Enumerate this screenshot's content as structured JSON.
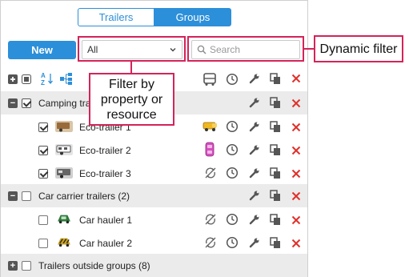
{
  "tabs": [
    {
      "label": "Trailers",
      "active": false
    },
    {
      "label": "Groups",
      "active": true
    }
  ],
  "toolbar": {
    "new_label": "New"
  },
  "filter": {
    "selected": "All"
  },
  "search": {
    "placeholder": "Search"
  },
  "callouts": {
    "dynamic_filter": "Dynamic filter",
    "filter_by": "Filter by property or resource"
  },
  "groups": [
    {
      "name": "Camping trailers (3)",
      "expanded": true,
      "checked": true,
      "items": [
        {
          "name": "Eco-trailer 1",
          "checked": true,
          "status_icon": "yellow-van-icon",
          "thumb_color": "#9a6b3a"
        },
        {
          "name": "Eco-trailer 2",
          "checked": true,
          "status_icon": "pink-trailer-icon",
          "thumb_color": "#777777"
        },
        {
          "name": "Eco-trailer 3",
          "checked": true,
          "status_icon": "sync-off-icon",
          "thumb_color": "#666666"
        }
      ]
    },
    {
      "name": "Car carrier trailers (2)",
      "expanded": true,
      "checked": false,
      "items": [
        {
          "name": "Car hauler 1",
          "checked": false,
          "status_icon": "sync-off-icon",
          "thumb_color": "#2f7a3a"
        },
        {
          "name": "Car hauler 2",
          "checked": false,
          "status_icon": "sync-off-icon",
          "thumb_color": "#c8a020"
        }
      ]
    },
    {
      "name": "Trailers outside groups (8)",
      "expanded": false,
      "checked": false,
      "items": []
    }
  ],
  "colors": {
    "accent": "#2c8fd9",
    "highlight": "#d3245a",
    "delete": "#e0302a"
  }
}
